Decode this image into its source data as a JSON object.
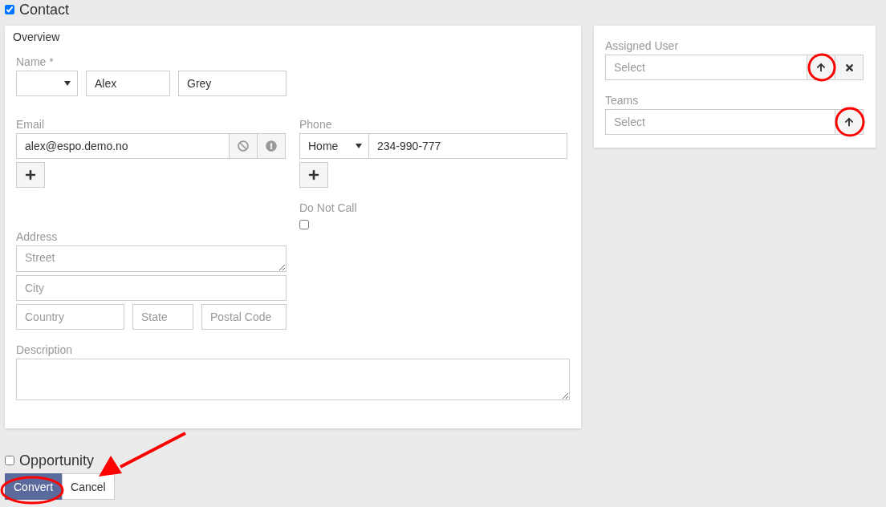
{
  "contact": {
    "label": "Contact",
    "checked": true
  },
  "overview": {
    "title": "Overview",
    "name": {
      "label": "Name *",
      "first": "Alex",
      "last": "Grey"
    },
    "email": {
      "label": "Email",
      "value": "alex@espo.demo.no"
    },
    "phone": {
      "label": "Phone",
      "type": "Home",
      "value": "234-990-777"
    },
    "do_not_call": {
      "label": "Do Not Call",
      "checked": false
    },
    "address": {
      "label": "Address",
      "street": {
        "placeholder": "Street"
      },
      "city": {
        "placeholder": "City"
      },
      "country": {
        "placeholder": "Country"
      },
      "state": {
        "placeholder": "State"
      },
      "postal_code": {
        "placeholder": "Postal Code"
      }
    },
    "description": {
      "label": "Description"
    }
  },
  "side_fields": [
    {
      "label": "Assigned User",
      "placeholder": "Select",
      "clearable": true
    },
    {
      "label": "Teams",
      "placeholder": "Select",
      "clearable": false
    }
  ],
  "opportunity": {
    "label": "Opportunity",
    "checked": false
  },
  "buttons": [
    {
      "label": "Convert",
      "kind": "primary"
    },
    {
      "label": "Cancel",
      "kind": "default"
    }
  ]
}
